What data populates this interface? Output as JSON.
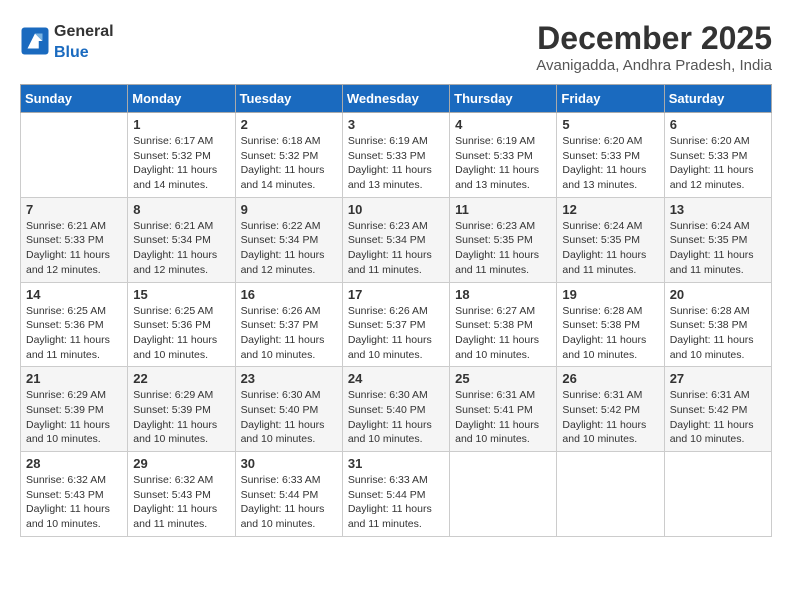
{
  "header": {
    "logo_general": "General",
    "logo_blue": "Blue",
    "month_title": "December 2025",
    "location": "Avanigadda, Andhra Pradesh, India"
  },
  "weekdays": [
    "Sunday",
    "Monday",
    "Tuesday",
    "Wednesday",
    "Thursday",
    "Friday",
    "Saturday"
  ],
  "weeks": [
    [
      {
        "day": "",
        "sunrise": "",
        "sunset": "",
        "daylight": ""
      },
      {
        "day": "1",
        "sunrise": "Sunrise: 6:17 AM",
        "sunset": "Sunset: 5:32 PM",
        "daylight": "Daylight: 11 hours and 14 minutes."
      },
      {
        "day": "2",
        "sunrise": "Sunrise: 6:18 AM",
        "sunset": "Sunset: 5:32 PM",
        "daylight": "Daylight: 11 hours and 14 minutes."
      },
      {
        "day": "3",
        "sunrise": "Sunrise: 6:19 AM",
        "sunset": "Sunset: 5:33 PM",
        "daylight": "Daylight: 11 hours and 13 minutes."
      },
      {
        "day": "4",
        "sunrise": "Sunrise: 6:19 AM",
        "sunset": "Sunset: 5:33 PM",
        "daylight": "Daylight: 11 hours and 13 minutes."
      },
      {
        "day": "5",
        "sunrise": "Sunrise: 6:20 AM",
        "sunset": "Sunset: 5:33 PM",
        "daylight": "Daylight: 11 hours and 13 minutes."
      },
      {
        "day": "6",
        "sunrise": "Sunrise: 6:20 AM",
        "sunset": "Sunset: 5:33 PM",
        "daylight": "Daylight: 11 hours and 12 minutes."
      }
    ],
    [
      {
        "day": "7",
        "sunrise": "Sunrise: 6:21 AM",
        "sunset": "Sunset: 5:33 PM",
        "daylight": "Daylight: 11 hours and 12 minutes."
      },
      {
        "day": "8",
        "sunrise": "Sunrise: 6:21 AM",
        "sunset": "Sunset: 5:34 PM",
        "daylight": "Daylight: 11 hours and 12 minutes."
      },
      {
        "day": "9",
        "sunrise": "Sunrise: 6:22 AM",
        "sunset": "Sunset: 5:34 PM",
        "daylight": "Daylight: 11 hours and 12 minutes."
      },
      {
        "day": "10",
        "sunrise": "Sunrise: 6:23 AM",
        "sunset": "Sunset: 5:34 PM",
        "daylight": "Daylight: 11 hours and 11 minutes."
      },
      {
        "day": "11",
        "sunrise": "Sunrise: 6:23 AM",
        "sunset": "Sunset: 5:35 PM",
        "daylight": "Daylight: 11 hours and 11 minutes."
      },
      {
        "day": "12",
        "sunrise": "Sunrise: 6:24 AM",
        "sunset": "Sunset: 5:35 PM",
        "daylight": "Daylight: 11 hours and 11 minutes."
      },
      {
        "day": "13",
        "sunrise": "Sunrise: 6:24 AM",
        "sunset": "Sunset: 5:35 PM",
        "daylight": "Daylight: 11 hours and 11 minutes."
      }
    ],
    [
      {
        "day": "14",
        "sunrise": "Sunrise: 6:25 AM",
        "sunset": "Sunset: 5:36 PM",
        "daylight": "Daylight: 11 hours and 11 minutes."
      },
      {
        "day": "15",
        "sunrise": "Sunrise: 6:25 AM",
        "sunset": "Sunset: 5:36 PM",
        "daylight": "Daylight: 11 hours and 10 minutes."
      },
      {
        "day": "16",
        "sunrise": "Sunrise: 6:26 AM",
        "sunset": "Sunset: 5:37 PM",
        "daylight": "Daylight: 11 hours and 10 minutes."
      },
      {
        "day": "17",
        "sunrise": "Sunrise: 6:26 AM",
        "sunset": "Sunset: 5:37 PM",
        "daylight": "Daylight: 11 hours and 10 minutes."
      },
      {
        "day": "18",
        "sunrise": "Sunrise: 6:27 AM",
        "sunset": "Sunset: 5:38 PM",
        "daylight": "Daylight: 11 hours and 10 minutes."
      },
      {
        "day": "19",
        "sunrise": "Sunrise: 6:28 AM",
        "sunset": "Sunset: 5:38 PM",
        "daylight": "Daylight: 11 hours and 10 minutes."
      },
      {
        "day": "20",
        "sunrise": "Sunrise: 6:28 AM",
        "sunset": "Sunset: 5:38 PM",
        "daylight": "Daylight: 11 hours and 10 minutes."
      }
    ],
    [
      {
        "day": "21",
        "sunrise": "Sunrise: 6:29 AM",
        "sunset": "Sunset: 5:39 PM",
        "daylight": "Daylight: 11 hours and 10 minutes."
      },
      {
        "day": "22",
        "sunrise": "Sunrise: 6:29 AM",
        "sunset": "Sunset: 5:39 PM",
        "daylight": "Daylight: 11 hours and 10 minutes."
      },
      {
        "day": "23",
        "sunrise": "Sunrise: 6:30 AM",
        "sunset": "Sunset: 5:40 PM",
        "daylight": "Daylight: 11 hours and 10 minutes."
      },
      {
        "day": "24",
        "sunrise": "Sunrise: 6:30 AM",
        "sunset": "Sunset: 5:40 PM",
        "daylight": "Daylight: 11 hours and 10 minutes."
      },
      {
        "day": "25",
        "sunrise": "Sunrise: 6:31 AM",
        "sunset": "Sunset: 5:41 PM",
        "daylight": "Daylight: 11 hours and 10 minutes."
      },
      {
        "day": "26",
        "sunrise": "Sunrise: 6:31 AM",
        "sunset": "Sunset: 5:42 PM",
        "daylight": "Daylight: 11 hours and 10 minutes."
      },
      {
        "day": "27",
        "sunrise": "Sunrise: 6:31 AM",
        "sunset": "Sunset: 5:42 PM",
        "daylight": "Daylight: 11 hours and 10 minutes."
      }
    ],
    [
      {
        "day": "28",
        "sunrise": "Sunrise: 6:32 AM",
        "sunset": "Sunset: 5:43 PM",
        "daylight": "Daylight: 11 hours and 10 minutes."
      },
      {
        "day": "29",
        "sunrise": "Sunrise: 6:32 AM",
        "sunset": "Sunset: 5:43 PM",
        "daylight": "Daylight: 11 hours and 11 minutes."
      },
      {
        "day": "30",
        "sunrise": "Sunrise: 6:33 AM",
        "sunset": "Sunset: 5:44 PM",
        "daylight": "Daylight: 11 hours and 10 minutes."
      },
      {
        "day": "31",
        "sunrise": "Sunrise: 6:33 AM",
        "sunset": "Sunset: 5:44 PM",
        "daylight": "Daylight: 11 hours and 11 minutes."
      },
      {
        "day": "",
        "sunrise": "",
        "sunset": "",
        "daylight": ""
      },
      {
        "day": "",
        "sunrise": "",
        "sunset": "",
        "daylight": ""
      },
      {
        "day": "",
        "sunrise": "",
        "sunset": "",
        "daylight": ""
      }
    ]
  ]
}
